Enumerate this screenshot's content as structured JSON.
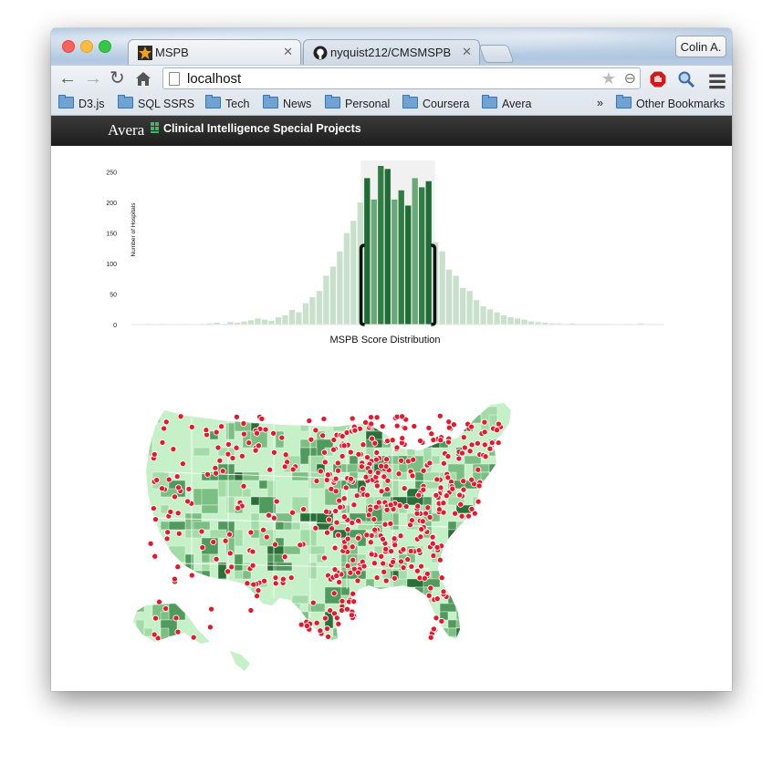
{
  "browser": {
    "tabs": [
      {
        "label": "MSPB",
        "favicon": "star-icon",
        "active": true
      },
      {
        "label": "nyquist212/CMSMSPB",
        "favicon": "github-icon",
        "active": false
      }
    ],
    "profile_label": "Colin A.",
    "url": "localhost",
    "bookmarks": [
      "D3.js",
      "SQL SSRS",
      "Tech",
      "News",
      "Personal",
      "Coursera",
      "Avera"
    ],
    "bookmarks_overflow": "»",
    "other_bookmarks": "Other Bookmarks"
  },
  "app": {
    "logo_text": "Avera",
    "title": "Clinical Intelligence Special Projects"
  },
  "chart_data": {
    "type": "bar",
    "title": "MSPB Score Distribution",
    "ylabel": "Number of Hospitals",
    "ylim": [
      0,
      260
    ],
    "yticks": [
      0,
      50,
      100,
      150,
      200,
      250
    ],
    "values": [
      0,
      0,
      1,
      0,
      1,
      0,
      0,
      1,
      1,
      0,
      1,
      2,
      3,
      1,
      4,
      3,
      5,
      7,
      10,
      8,
      6,
      12,
      15,
      24,
      20,
      35,
      45,
      55,
      80,
      95,
      120,
      150,
      170,
      200,
      240,
      205,
      260,
      255,
      205,
      220,
      195,
      240,
      225,
      235,
      135,
      120,
      90,
      80,
      60,
      55,
      40,
      30,
      25,
      20,
      15,
      12,
      10,
      8,
      5,
      4,
      3,
      2,
      2,
      1,
      2,
      1,
      1,
      1,
      1,
      1,
      1,
      0,
      1,
      0,
      2,
      1,
      1,
      0
    ],
    "brush_range": [
      34,
      43
    ],
    "colors": {
      "selected": [
        "#2e7d43",
        "#1e6b34",
        "#6aa878"
      ],
      "unselected": "#c9e0cc",
      "brush_handle": "#111111"
    }
  },
  "map": {
    "region": "United States",
    "fill_colors": [
      "#c6f0c8",
      "#a4dca8",
      "#7cbf83",
      "#4f9a5c",
      "#2a6e38"
    ],
    "marker_color": "#e8182a",
    "marker_outline": "#ffffff"
  }
}
